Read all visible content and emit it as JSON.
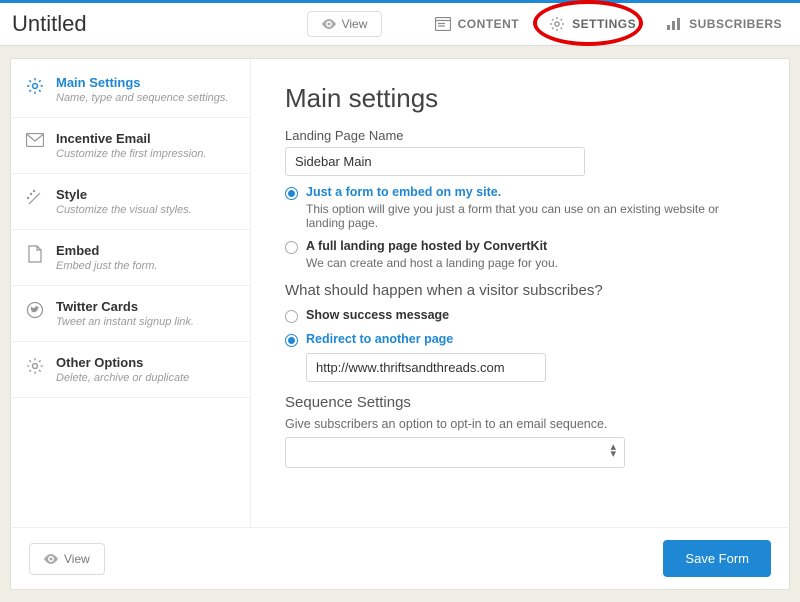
{
  "header": {
    "title": "Untitled",
    "view_label": "View",
    "nav": {
      "content": "CONTENT",
      "settings": "SETTINGS",
      "subscribers": "SUBSCRIBERS"
    }
  },
  "sidebar": {
    "items": [
      {
        "title": "Main Settings",
        "sub": "Name, type and sequence settings."
      },
      {
        "title": "Incentive Email",
        "sub": "Customize the first impression."
      },
      {
        "title": "Style",
        "sub": "Customize the visual styles."
      },
      {
        "title": "Embed",
        "sub": "Embed just the form."
      },
      {
        "title": "Twitter Cards",
        "sub": "Tweet an instant signup link."
      },
      {
        "title": "Other Options",
        "sub": "Delete, archive or duplicate"
      }
    ]
  },
  "main": {
    "heading": "Main settings",
    "name_label": "Landing Page Name",
    "name_value": "Sidebar Main",
    "type_options": [
      {
        "label": "Just a form to embed on my site.",
        "desc": "This option will give you just a form that you can use on an existing website or landing page.",
        "checked": true
      },
      {
        "label": "A full landing page hosted by ConvertKit",
        "desc": "We can create and host a landing page for you.",
        "checked": false
      }
    ],
    "subscribe_heading": "What should happen when a visitor subscribes?",
    "subscribe_options": [
      {
        "label": "Show success message",
        "checked": false
      },
      {
        "label": "Redirect to another page",
        "checked": true
      }
    ],
    "redirect_url": "http://www.thriftsandthreads.com",
    "sequence_heading": "Sequence Settings",
    "sequence_desc": "Give subscribers an option to opt-in to an email sequence."
  },
  "footer": {
    "view_label": "View",
    "save_label": "Save Form"
  },
  "colors": {
    "accent": "#1e88d4"
  }
}
